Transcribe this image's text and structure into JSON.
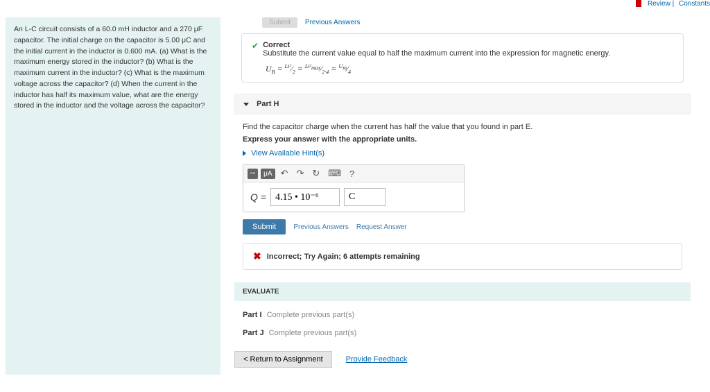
{
  "top_links": {
    "review": "Review",
    "constants": "Constants"
  },
  "problem_text": "An L-C circuit consists of a 60.0 mH inductor and a 270 μF capacitor. The initial charge on the capacitor is 5.00 μC and the initial current in the inductor is 0.600 mA. (a) What is the maximum energy stored in the inductor? (b) What is the maximum current in the inductor? (c) What is the maximum voltage across the capacitor? (d) When the current in the inductor has half its maximum value, what are the energy stored in the inductor and the voltage across the capacitor?",
  "prev_answers_label": "Previous Answers",
  "submit_gray": "Submit",
  "correct": {
    "title": "Correct",
    "sub": "Substitute the current value equal to half the maximum current into the expression for magnetic energy.",
    "formula": "U_B = Li² / 2 = Li²_max / 2·4 = U_m / 4"
  },
  "part_h": {
    "label": "Part H",
    "prompt": "Find the capacitor charge when the current has half the value that you found in part E.",
    "express": "Express your answer with the appropriate units.",
    "hints": "View Available Hint(s)",
    "var": "Q =",
    "value": "4.15 • 10⁻⁶",
    "unit": "C",
    "submit": "Submit",
    "prev": "Previous Answers",
    "req": "Request Answer",
    "feedback": "Incorrect; Try Again; 6 attempts remaining"
  },
  "toolbar": {
    "uA": "μA",
    "undo": "↶",
    "redo": "↷",
    "reset": "↻",
    "kb": "⌨",
    "help": "?"
  },
  "evaluate": "EVALUATE",
  "part_i": {
    "label": "Part I",
    "msg": "Complete previous part(s)"
  },
  "part_j": {
    "label": "Part J",
    "msg": "Complete previous part(s)"
  },
  "footer": {
    "return": "< Return to Assignment",
    "feedback": "Provide Feedback"
  }
}
